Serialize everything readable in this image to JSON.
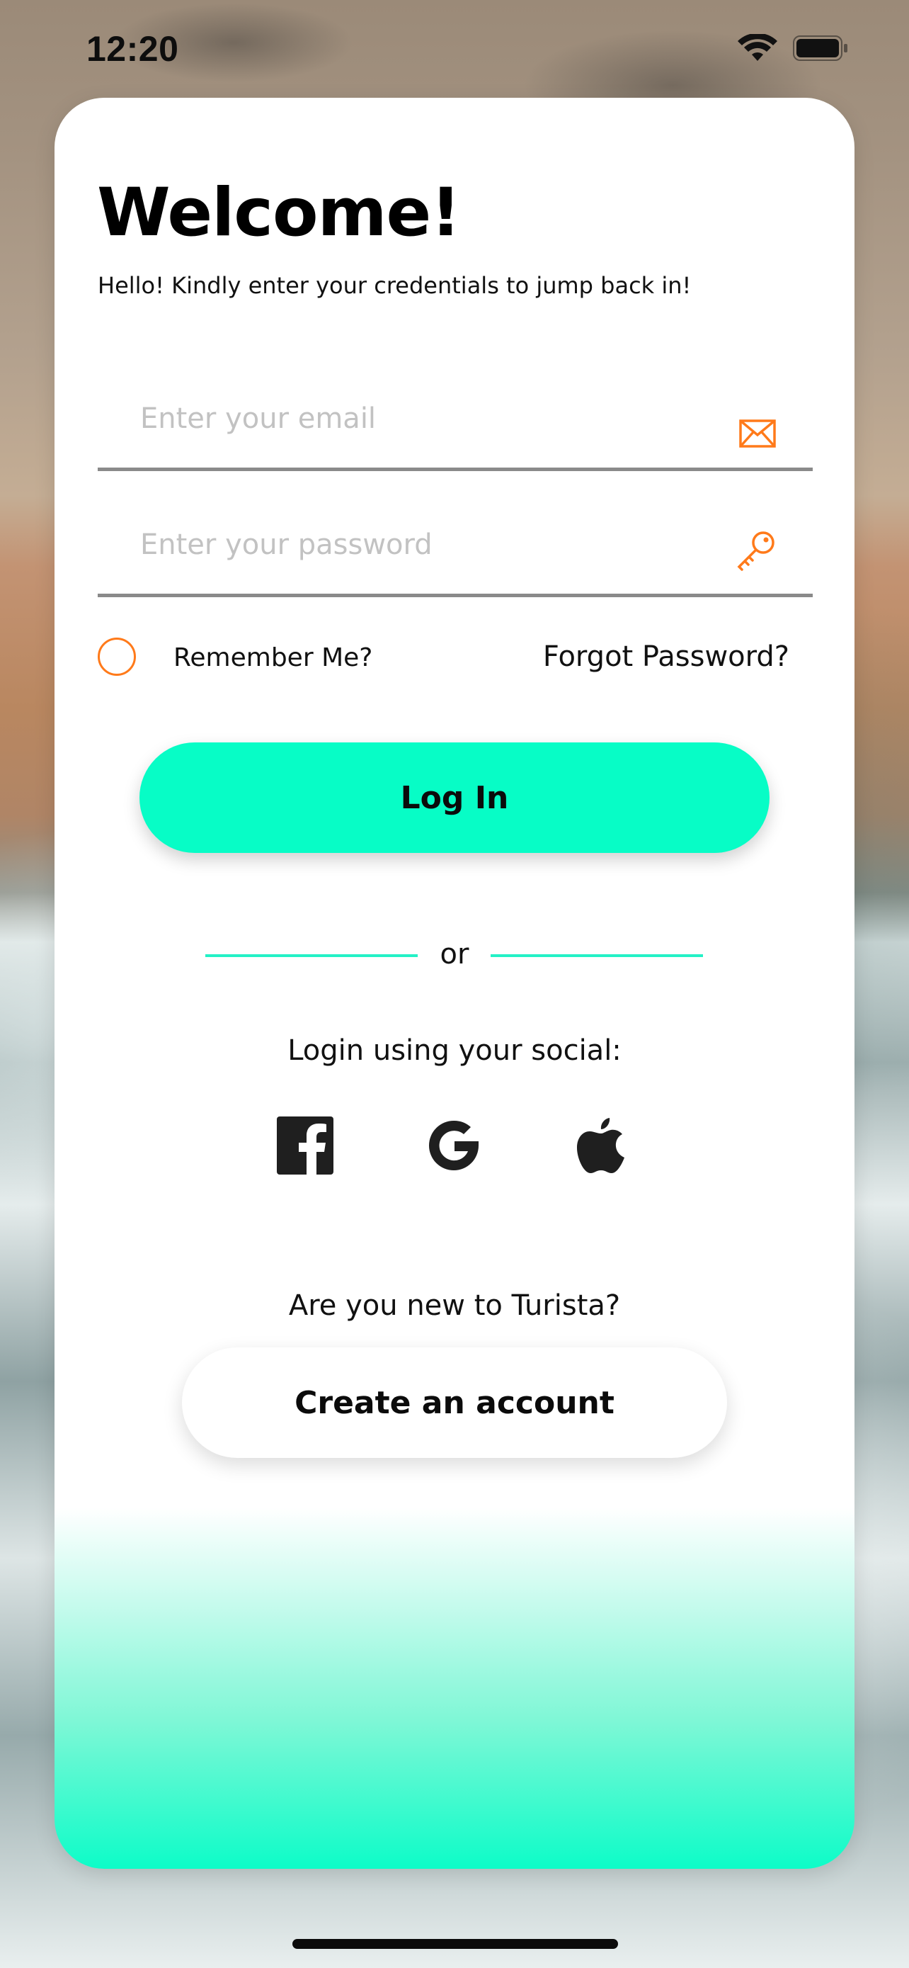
{
  "status_bar": {
    "time": "12:20",
    "icons": [
      "wifi-icon",
      "battery-icon"
    ]
  },
  "welcome": {
    "title": "Welcome!",
    "subtitle": "Hello! Kindly enter your credentials to jump back in!"
  },
  "form": {
    "email_placeholder": "Enter your email",
    "email_value": "",
    "email_icon": "envelope-icon",
    "password_placeholder": "Enter your password",
    "password_value": "",
    "password_icon": "key-icon",
    "remember_label": "Remember Me?",
    "remember_checked": false,
    "forgot_label": "Forgot Password?",
    "login_label": "Log In"
  },
  "social": {
    "divider_text": "or",
    "heading": "Login using your social:",
    "providers": [
      "facebook-icon",
      "google-icon",
      "apple-icon"
    ]
  },
  "signup": {
    "prompt": "Are you new to Turista?",
    "button_label": "Create an account"
  },
  "colors": {
    "accent": "#07fdc6",
    "icon_orange": "#ff7a1a",
    "text": "#111111"
  }
}
